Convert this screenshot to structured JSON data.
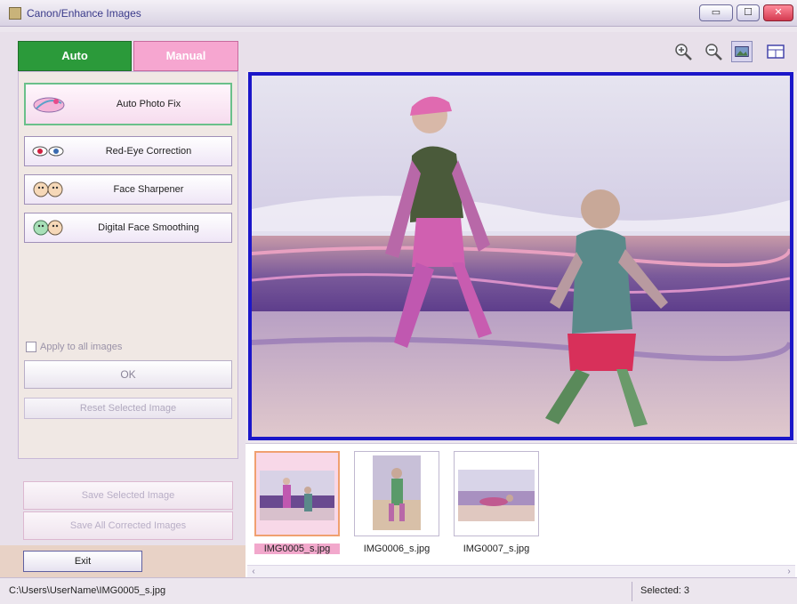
{
  "window": {
    "title": "Canon/Enhance Images",
    "min_label": "▭",
    "max_label": "☐",
    "close_label": "✕"
  },
  "tabs": [
    {
      "label": "Auto",
      "active": true
    },
    {
      "label": "Manual",
      "active": false
    }
  ],
  "corrections": [
    {
      "label": "Auto Photo Fix",
      "icon": "auto-photo-fix-icon"
    },
    {
      "label": "Red-Eye Correction",
      "icon": "red-eye-icon"
    },
    {
      "label": "Face Sharpener",
      "icon": "face-sharpener-icon"
    },
    {
      "label": "Digital Face Smoothing",
      "icon": "face-smoothing-icon"
    }
  ],
  "apply_all_label": "Apply to all images",
  "ok_label": "OK",
  "reset_label": "Reset Selected Image",
  "save_selected_label": "Save Selected Image",
  "save_all_label": "Save All Corrected Images",
  "exit_label": "Exit",
  "thumbnails": [
    {
      "filename": "IMG0005_s.jpg",
      "selected": true
    },
    {
      "filename": "IMG0006_s.jpg",
      "selected": false
    },
    {
      "filename": "IMG0007_s.jpg",
      "selected": false
    }
  ],
  "status": {
    "path": "C:\\Users\\UserName\\IMG0005_s.jpg",
    "selected": "Selected: 3"
  },
  "colors": {
    "auto_tab": "#2b9a3a",
    "manual_tab": "#f6a6d0",
    "preview_border": "#1b16c9"
  }
}
